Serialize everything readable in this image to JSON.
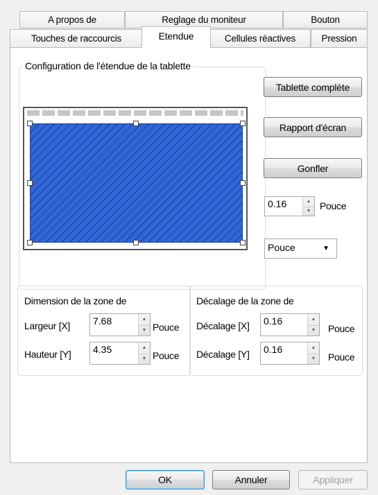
{
  "tabs_row1": [
    {
      "label": "A propos de"
    },
    {
      "label": "Reglage du moniteur"
    },
    {
      "label": "Bouton"
    }
  ],
  "tabs_row2": [
    {
      "label": "Touches de raccourcis"
    },
    {
      "label": "Etendue",
      "active": true
    },
    {
      "label": "Cellules réactives"
    },
    {
      "label": "Pression"
    }
  ],
  "tablet_area": {
    "title": "Configuration de l'étendue de la tablette",
    "fill_color": "#2f67d8",
    "full_tablet_label": "Tablette complète",
    "screen_ratio_label": "Rapport d'écran",
    "inflate_label": "Gonfler",
    "inflate_value": "0.16",
    "inflate_unit": "Pouce",
    "unit_select": "Pouce"
  },
  "dimension": {
    "title": "Dimension de la zone de",
    "width_label": "Largeur [X]",
    "width_value": "7.68",
    "width_unit": "Pouce",
    "height_label": "Hauteur [Y]",
    "height_value": "4.35",
    "height_unit": "Pouce"
  },
  "offset": {
    "title": "Décalage de la zone de",
    "x_label": "Décalage [X]",
    "x_value": "0.16",
    "x_unit": "Pouce",
    "y_label": "Décalage [Y]",
    "y_value": "0.16",
    "y_unit": "Pouce"
  },
  "footer": {
    "ok_label": "OK",
    "cancel_label": "Annuler",
    "apply_label": "Appliquer"
  }
}
